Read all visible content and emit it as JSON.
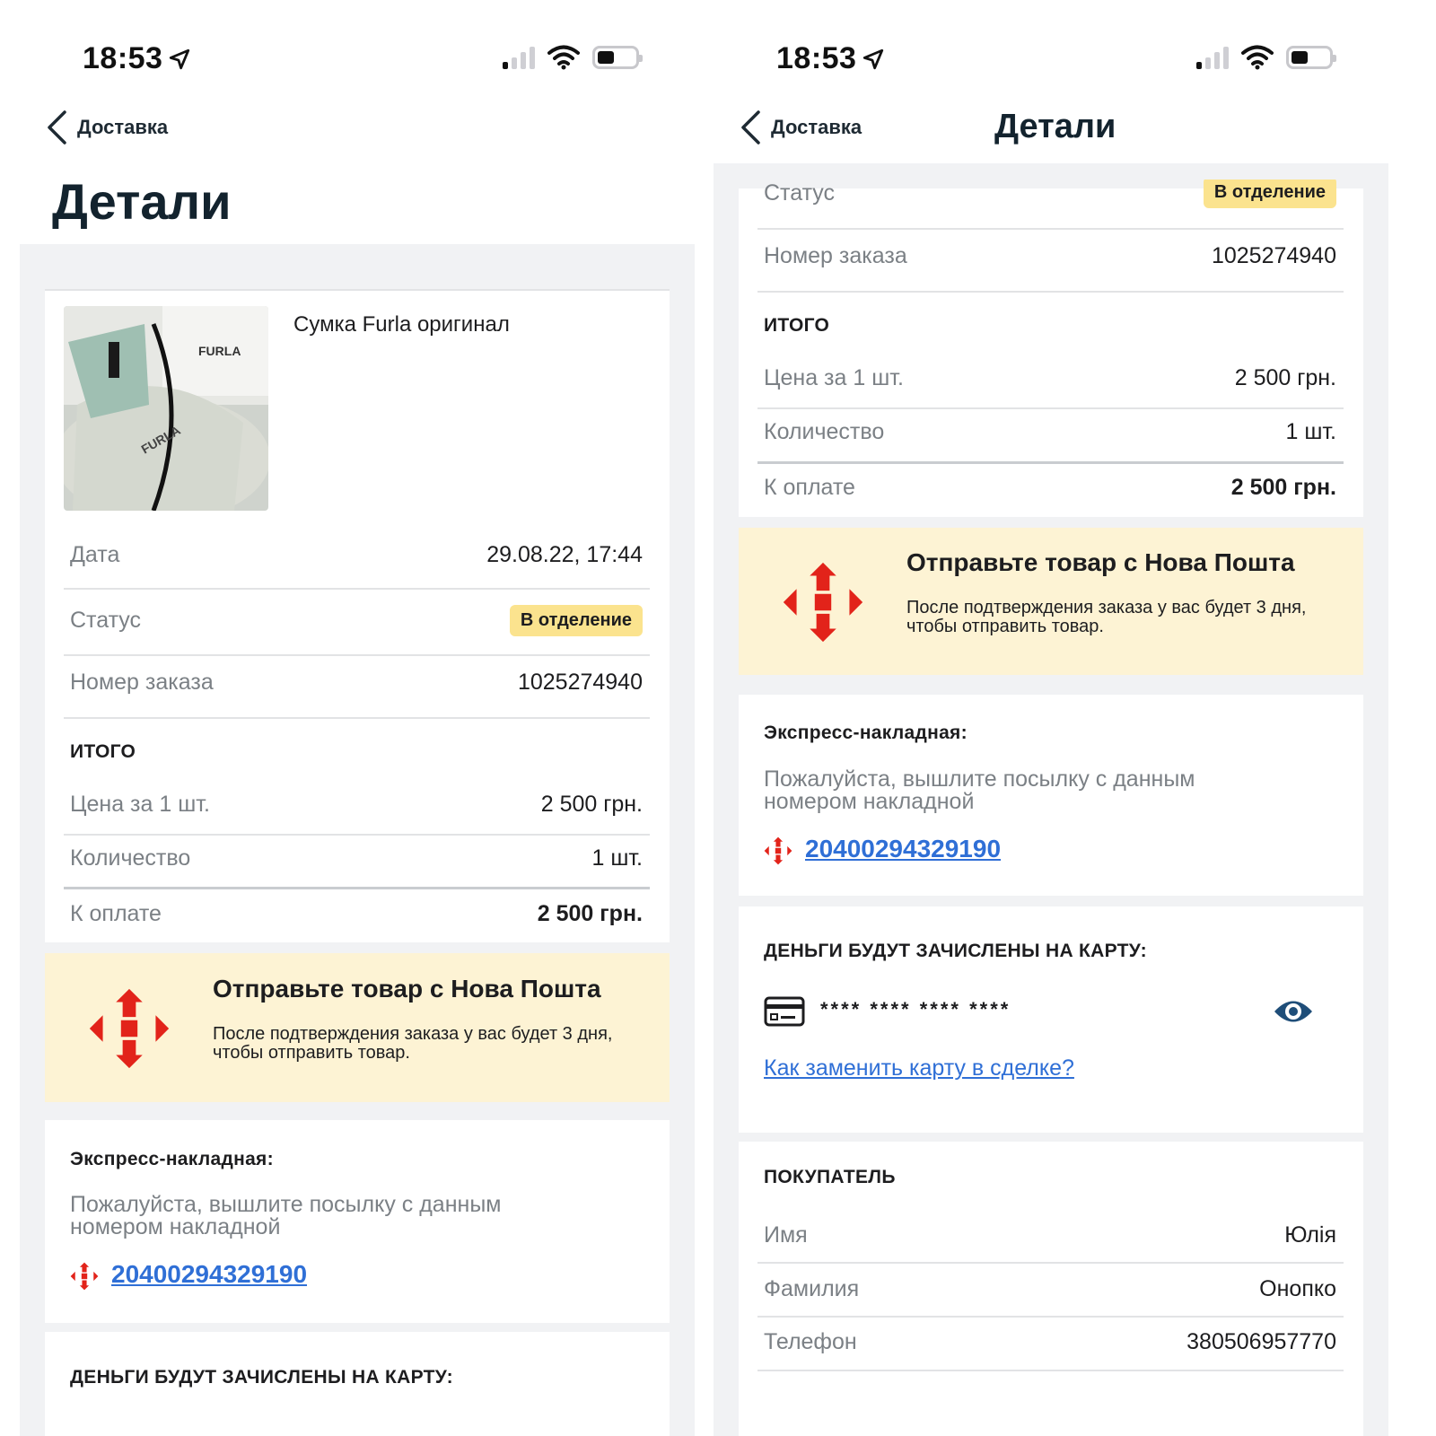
{
  "status_bar": {
    "time": "18:53"
  },
  "nav": {
    "back_label": "Доставка",
    "title": "Детали"
  },
  "product": {
    "title": "Сумка Furla оригинал",
    "image_label": "FURLA"
  },
  "details": {
    "date_label": "Дата",
    "date_value": "29.08.22, 17:44",
    "status_label": "Статус",
    "status_value": "В отделение",
    "order_label": "Номер заказа",
    "order_value": "1025274940"
  },
  "totals": {
    "header": "ИТОГО",
    "price_label": "Цена за 1 шт.",
    "price_value": "2 500 грн.",
    "qty_label": "Количество",
    "qty_value": "1 шт.",
    "pay_label": "К оплате",
    "pay_value": "2 500 грн."
  },
  "nova_poshta": {
    "title": "Отправьте товар с Нова Пошта",
    "text_line1": "После подтверждения заказа у вас будет 3 дня,",
    "text_line2": "чтобы отправить товар."
  },
  "waybill": {
    "header": "Экспресс-накладная:",
    "text_line1": "Пожалуйста, вышлите посылку с данным",
    "text_line2": "номером накладной",
    "number": "20400294329190"
  },
  "payout": {
    "header": "ДЕНЬГИ БУДУТ ЗАЧИСЛЕНЫ НА КАРТУ:",
    "card_mask": "**** **** **** ****",
    "help_link": "Как заменить карту в сделке?"
  },
  "buyer": {
    "header": "ПОКУПАТЕЛЬ",
    "name_label": "Имя",
    "name_value": "Юлія",
    "surname_label": "Фамилия",
    "surname_value": "Онопко",
    "phone_label": "Телефон",
    "phone_value": "380506957770"
  },
  "colors": {
    "accent_link": "#2f6fd6",
    "badge_bg": "#fbe38e",
    "banner_bg": "#fdf3d4",
    "np_red": "#e2231a",
    "eye_icon": "#1f4e79"
  },
  "icons": [
    "location-arrow-icon",
    "signal-icon",
    "wifi-icon",
    "battery-icon",
    "chevron-left-icon",
    "nova-poshta-logo-icon",
    "credit-card-icon",
    "eye-icon"
  ]
}
